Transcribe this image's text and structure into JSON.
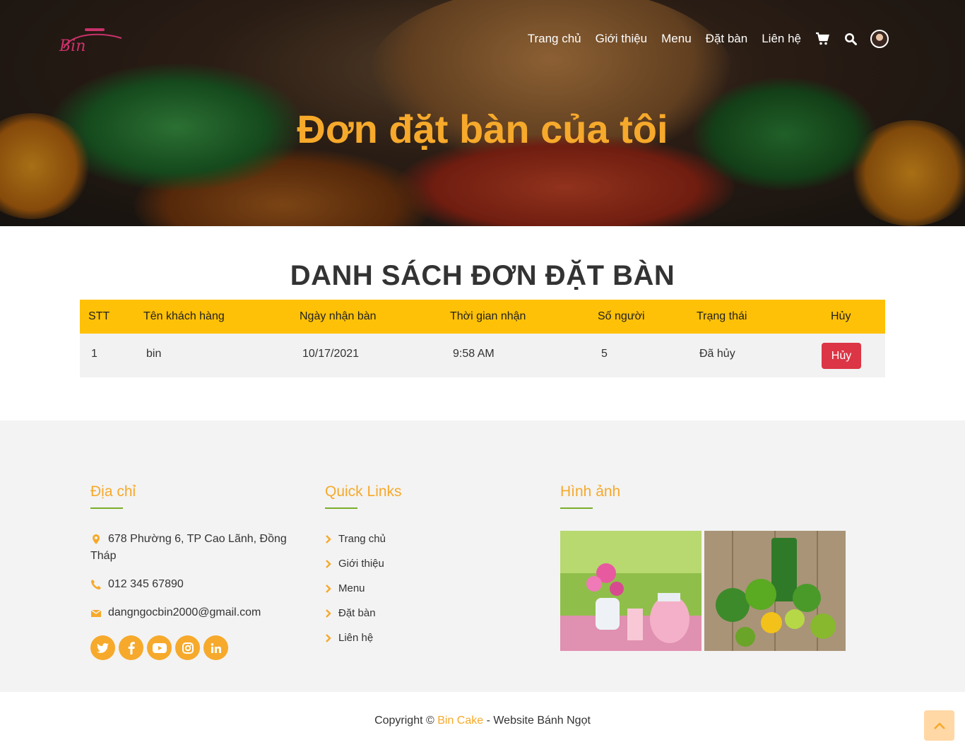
{
  "nav": {
    "logo_text": "Bin",
    "items": [
      "Trang chủ",
      "Giới thiệu",
      "Menu",
      "Đặt bàn",
      "Liên hệ"
    ],
    "icons": [
      "cart-icon",
      "search-icon",
      "avatar"
    ]
  },
  "hero": {
    "title": "Đơn đặt bàn của tôi"
  },
  "bookings": {
    "title": "DANH SÁCH ĐƠN ĐẶT BÀN",
    "columns": [
      "STT",
      "Tên khách hàng",
      "Ngày nhận bàn",
      "Thời gian nhận",
      "Số người",
      "Trạng thái",
      "Hủy"
    ],
    "rows": [
      {
        "stt": "1",
        "name": "bin",
        "date": "10/17/2021",
        "time": "9:58 AM",
        "people": "5",
        "status": "Đã hủy",
        "action": "Hủy"
      }
    ]
  },
  "footer": {
    "address_title": "Địa chỉ",
    "address_line1": "678 Phường 6, TP Cao Lãnh, Đồng",
    "address_line2": "Tháp",
    "phone": "012 345 67890",
    "email": "dangngocbin2000@gmail.com",
    "socials": [
      "twitter-icon",
      "facebook-icon",
      "youtube-icon",
      "instagram-icon",
      "linkedin-icon"
    ],
    "quick_links_title": "Quick Links",
    "quick_links": [
      "Trang chủ",
      "Giới thiệu",
      "Menu",
      "Đặt bàn",
      "Liên hệ"
    ],
    "gallery_title": "Hình ảnh"
  },
  "copyright": {
    "prefix": "Copyright © ",
    "brand": "Bin Cake",
    "suffix": " - Website Bánh Ngọt"
  },
  "colors": {
    "accent": "#f6a92b",
    "table_header": "#ffc107",
    "danger": "#dc3545",
    "underline": "#7cae2a"
  }
}
